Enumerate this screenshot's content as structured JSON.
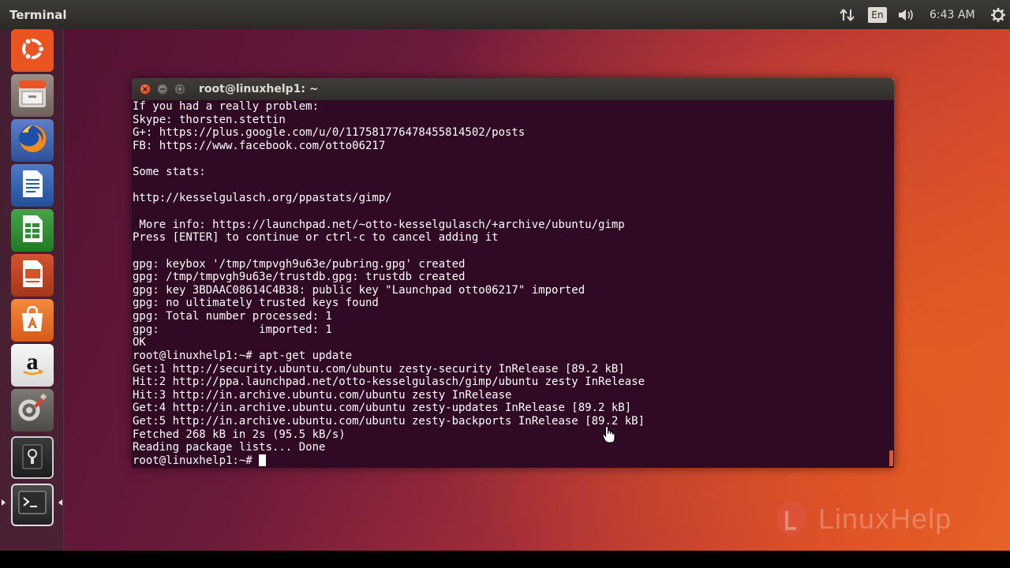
{
  "topbar": {
    "app_title": "Terminal",
    "keyboard_layout": "En",
    "clock": "6:43 AM",
    "icons": [
      "network-transfer-icon",
      "volume-icon",
      "settings-gear-icon"
    ]
  },
  "launcher": {
    "items": [
      {
        "name": "ubuntu-dash",
        "icon": "ubuntu-logo-icon"
      },
      {
        "name": "files",
        "icon": "file-cabinet-icon"
      },
      {
        "name": "firefox",
        "icon": "firefox-icon"
      },
      {
        "name": "libreoffice-writer",
        "icon": "writer-document-icon"
      },
      {
        "name": "libreoffice-calc",
        "icon": "calc-spreadsheet-icon"
      },
      {
        "name": "libreoffice-impress",
        "icon": "impress-presentation-icon"
      },
      {
        "name": "ubuntu-software",
        "icon": "software-bag-icon"
      },
      {
        "name": "amazon",
        "icon": "amazon-icon"
      },
      {
        "name": "system-settings",
        "icon": "settings-tools-icon"
      },
      {
        "name": "removable-drive",
        "icon": "drive-icon"
      },
      {
        "name": "terminal",
        "icon": "terminal-icon"
      }
    ]
  },
  "terminal": {
    "window_title": "root@linuxhelp1: ~",
    "lines": [
      "If you had a really problem:",
      "Skype: thorsten.stettin",
      "G+: https://plus.google.com/u/0/117581776478455814502/posts",
      "FB: https://www.facebook.com/otto06217",
      "",
      "Some stats:",
      "",
      "http://kesselgulasch.org/ppastats/gimp/",
      "",
      " More info: https://launchpad.net/~otto-kesselgulasch/+archive/ubuntu/gimp",
      "Press [ENTER] to continue or ctrl-c to cancel adding it",
      "",
      "gpg: keybox '/tmp/tmpvgh9u63e/pubring.gpg' created",
      "gpg: /tmp/tmpvgh9u63e/trustdb.gpg: trustdb created",
      "gpg: key 3BDAAC08614C4B38: public key \"Launchpad otto06217\" imported",
      "gpg: no ultimately trusted keys found",
      "gpg: Total number processed: 1",
      "gpg:               imported: 1",
      "OK",
      "root@linuxhelp1:~# apt-get update",
      "Get:1 http://security.ubuntu.com/ubuntu zesty-security InRelease [89.2 kB]",
      "Hit:2 http://ppa.launchpad.net/otto-kesselgulasch/gimp/ubuntu zesty InRelease",
      "Hit:3 http://in.archive.ubuntu.com/ubuntu zesty InRelease",
      "Get:4 http://in.archive.ubuntu.com/ubuntu zesty-updates InRelease [89.2 kB]",
      "Get:5 http://in.archive.ubuntu.com/ubuntu zesty-backports InRelease [89.2 kB]",
      "Fetched 268 kB in 2s (95.5 kB/s)",
      "Reading package lists... Done"
    ],
    "prompt": "root@linuxhelp1:~# "
  },
  "watermark": {
    "text": "LinuxHelp"
  },
  "colors": {
    "terminal_bg": "#300a24",
    "accent": "#e95420",
    "panel": "#3c3b37"
  }
}
